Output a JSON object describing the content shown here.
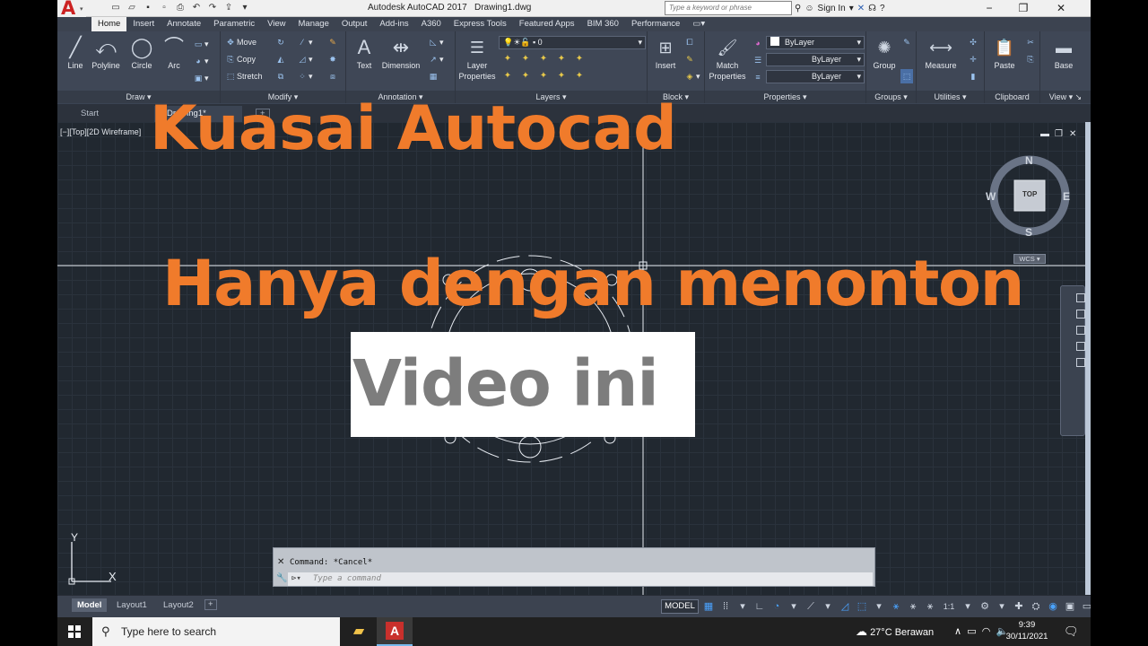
{
  "titlebar": {
    "app_title": "Autodesk AutoCAD 2017",
    "document": "Drawing1.dwg",
    "search_placeholder": "Type a keyword or phrase",
    "sign_in": "Sign In"
  },
  "ribbon_tabs": [
    "Home",
    "Insert",
    "Annotate",
    "Parametric",
    "View",
    "Manage",
    "Output",
    "Add-ins",
    "A360",
    "Express Tools",
    "Featured Apps",
    "BIM 360",
    "Performance"
  ],
  "ribbon": {
    "draw": {
      "title": "Draw",
      "line": "Line",
      "polyline": "Polyline",
      "circle": "Circle",
      "arc": "Arc"
    },
    "modify": {
      "title": "Modify",
      "move": "Move",
      "copy": "Copy",
      "stretch": "Stretch"
    },
    "annotation": {
      "title": "Annotation",
      "text": "Text",
      "dimension": "Dimension"
    },
    "layers": {
      "title": "Layers",
      "layer_properties": "Layer Properties",
      "current_layer": "0"
    },
    "block": {
      "title": "Block",
      "insert": "Insert"
    },
    "properties": {
      "title": "Properties",
      "match_properties": "Match Properties",
      "color": "ByLayer",
      "linetype": "ByLayer",
      "lineweight": "ByLayer"
    },
    "groups": {
      "title": "Groups",
      "group": "Group"
    },
    "utilities": {
      "title": "Utilities",
      "measure": "Measure"
    },
    "clipboard": {
      "title": "Clipboard",
      "paste": "Paste"
    },
    "view": {
      "title": "View",
      "base": "Base"
    }
  },
  "file_tabs": {
    "start": "Start",
    "drawing": "Drawing1*"
  },
  "viewport": {
    "label": "[−][Top][2D Wireframe]",
    "viewcube": {
      "n": "N",
      "s": "S",
      "e": "E",
      "w": "W",
      "top": "TOP",
      "wcs": "WCS"
    },
    "ucs": {
      "y": "Y",
      "x": "X"
    }
  },
  "overlay": {
    "line1": "Kuasai Autocad",
    "line2": "Hanya dengan menonton",
    "line3": "Video ini"
  },
  "command_line": {
    "history": "Command: *Cancel*",
    "placeholder": "Type a command"
  },
  "layout_tabs": [
    "Model",
    "Layout1",
    "Layout2"
  ],
  "status_bar": {
    "model": "MODEL",
    "scale": "1:1"
  },
  "taskbar": {
    "search": "Type here to search",
    "weather": "27°C  Berawan",
    "time": "9:39",
    "date": "30/11/2021"
  },
  "colors": {
    "overlay_orange": "#f07b2b",
    "grid_bg": "#212830",
    "ribbon_bg": "#3f4756"
  }
}
